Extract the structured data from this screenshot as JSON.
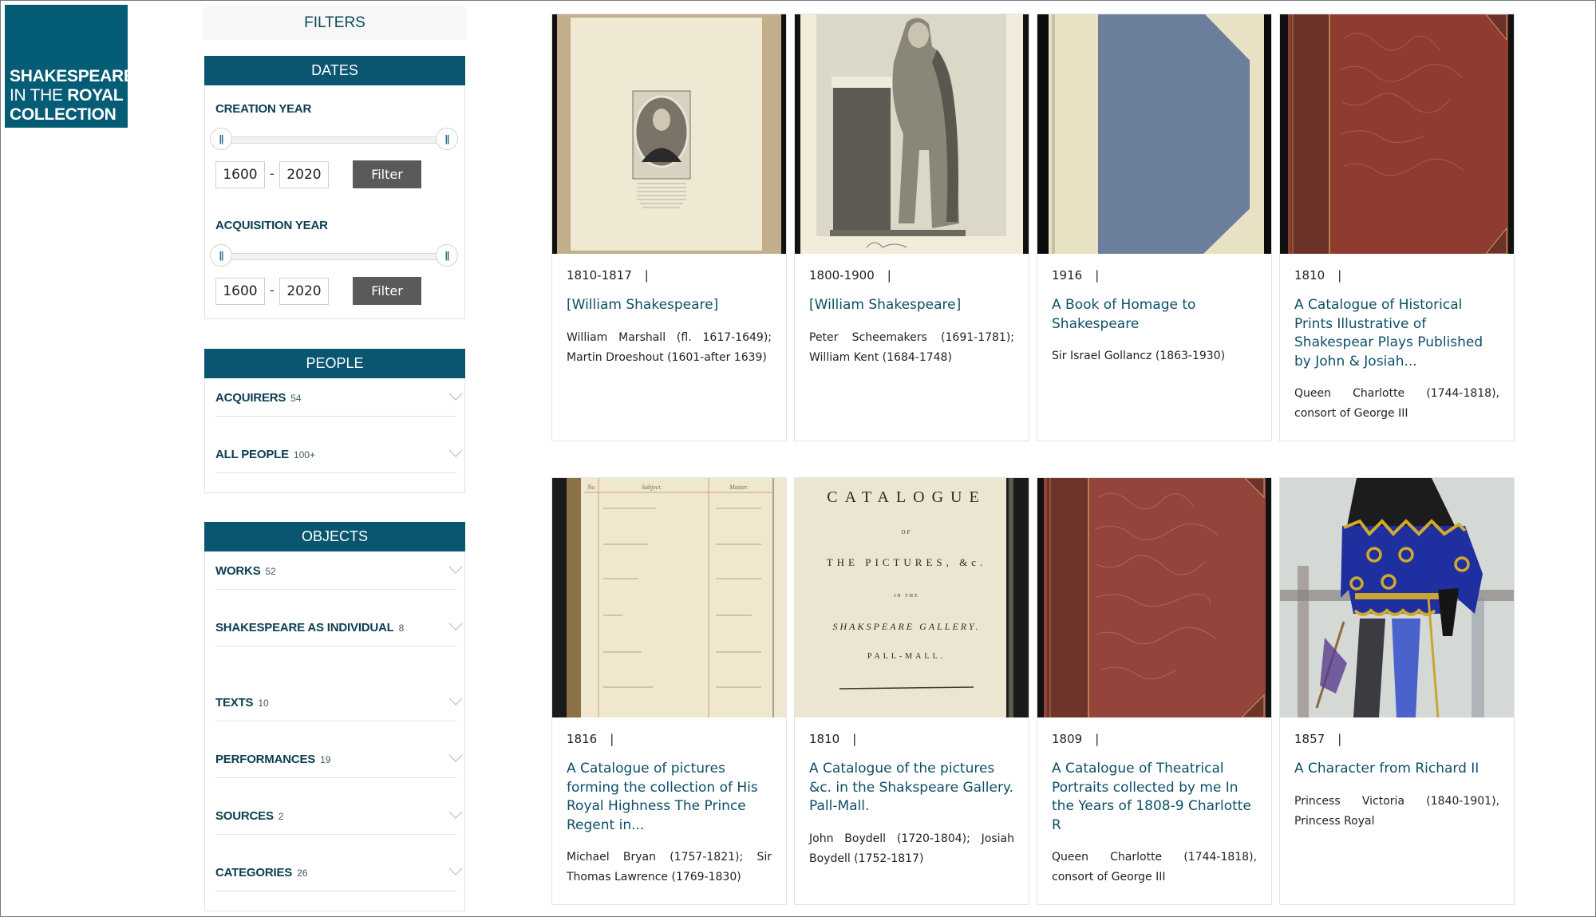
{
  "logo": {
    "line1": "SHAKESPEARE",
    "line2_thin": "IN THE ",
    "line2_bold": "ROYAL",
    "line3": "COLLECTION",
    "color": "#055c75"
  },
  "sidebar": {
    "title": "FILTERS",
    "dates": {
      "heading": "DATES",
      "creation": {
        "label": "CREATION YEAR",
        "from": "1600",
        "to": "2020",
        "separator": "-",
        "button": "Filter",
        "handle_glyph": "||",
        "range_fraction": [
          0,
          1
        ]
      },
      "acquisition": {
        "label": "ACQUISITION YEAR",
        "from": "1600",
        "to": "2020",
        "separator": "-",
        "button": "Filter",
        "handle_glyph": "||",
        "range_fraction": [
          0,
          1
        ]
      }
    },
    "people": {
      "heading": "PEOPLE",
      "items": [
        {
          "label": "ACQUIRERS",
          "count": "54",
          "icon": "chevron-down-icon"
        },
        {
          "label": "ALL PEOPLE",
          "count": "100+",
          "icon": "chevron-down-icon"
        }
      ]
    },
    "objects": {
      "heading": "OBJECTS",
      "items": [
        {
          "label": "WORKS",
          "count": "52",
          "icon": "chevron-down-icon"
        },
        {
          "label": "SHAKESPEARE AS INDIVIDUAL",
          "count": "8",
          "icon": "chevron-down-icon"
        },
        {
          "label": "TEXTS",
          "count": "10",
          "icon": "chevron-down-icon"
        },
        {
          "label": "PERFORMANCES",
          "count": "19",
          "icon": "chevron-down-icon"
        },
        {
          "label": "SOURCES",
          "count": "2",
          "icon": "chevron-down-icon"
        },
        {
          "label": "CATEGORIES",
          "count": "26",
          "icon": "chevron-down-icon"
        }
      ]
    }
  },
  "results": {
    "separator": "|",
    "cards": [
      {
        "date": "1810-1817",
        "title": "[William Shakespeare]",
        "people": "William Marshall (fl. 1617-1649); Martin Droeshout (1601-after 1639)",
        "image": "engraved-portrait-thumbnail"
      },
      {
        "date": "1800-1900",
        "title": "[William Shakespeare]",
        "people": "Peter Scheemakers (1691-1781); William Kent (1684-1748)",
        "image": "statue-engraving-thumbnail"
      },
      {
        "date": "1916",
        "title": "A Book of Homage to Shakespeare",
        "people": "Sir Israel Gollancz (1863-1930)",
        "image": "blue-book-cover-thumbnail"
      },
      {
        "date": "1810",
        "title": "A Catalogue of Historical Prints Illustrative of Shakespear Plays Published by John & Josiah...",
        "people": "Queen Charlotte (1744-1818), consort of George III",
        "image": "red-book-cover-thumbnail"
      },
      {
        "date": "1816",
        "title": "A Catalogue of pictures forming the collection of His Royal Highness The Prince Regent in...",
        "people": "Michael Bryan (1757-1821); Sir Thomas Lawrence (1769-1830)",
        "image": "manuscript-ledger-thumbnail"
      },
      {
        "date": "1810",
        "title": "A Catalogue of the pictures &c. in the Shakspeare Gallery. Pall-Mall.",
        "people": "John Boydell (1720-1804); Josiah Boydell (1752-1817)",
        "image": "title-page-thumbnail",
        "image_text": {
          "l1": "CATALOGUE",
          "l2": "OF",
          "l3": "THE PICTURES, &c.",
          "l4": "IN THE",
          "l5": "SHAKSPEARE GALLERY.",
          "l6": "PALL-MALL."
        }
      },
      {
        "date": "1809",
        "title": "A Catalogue of Theatrical Portraits collected by me In the Years of 1808-9 Charlotte R",
        "people": "Queen Charlotte (1744-1818), consort of George III",
        "image": "red-book-cover-thumbnail"
      },
      {
        "date": "1857",
        "title": "A Character from Richard II",
        "people": "Princess Victoria (1840-1901), Princess Royal",
        "image": "watercolour-figure-thumbnail"
      }
    ]
  }
}
